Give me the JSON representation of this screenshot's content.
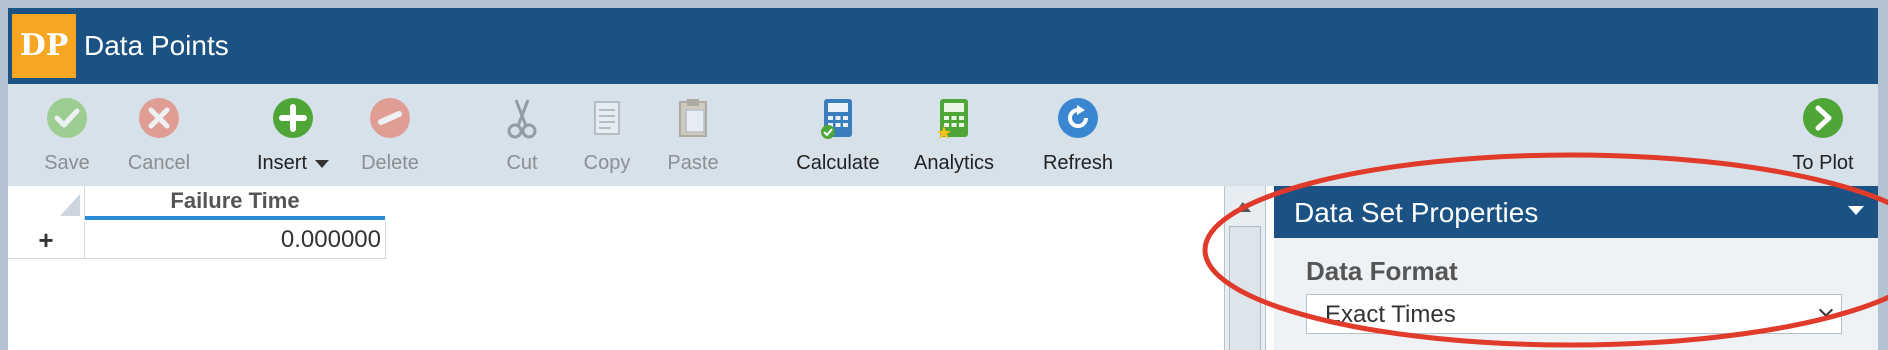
{
  "app": {
    "logo_text": "DP",
    "title": "Data Points"
  },
  "toolbar": {
    "save": "Save",
    "cancel": "Cancel",
    "insert": "Insert",
    "delete": "Delete",
    "cut": "Cut",
    "copy": "Copy",
    "paste": "Paste",
    "calculate": "Calculate",
    "analytics": "Analytics",
    "refresh": "Refresh",
    "to_plot": "To Plot"
  },
  "grid": {
    "columns": [
      "Failure Time"
    ],
    "new_row_marker": "+",
    "rows": [
      [
        "0.000000"
      ]
    ]
  },
  "panel": {
    "title": "Data Set Properties",
    "field_label": "Data Format",
    "field_value": "Exact Times"
  },
  "colors": {
    "header_blue": "#1b5283",
    "logo_orange": "#f6a623",
    "toolbar_bg": "#d7e1ea",
    "annotation_red": "#e03a2a"
  }
}
